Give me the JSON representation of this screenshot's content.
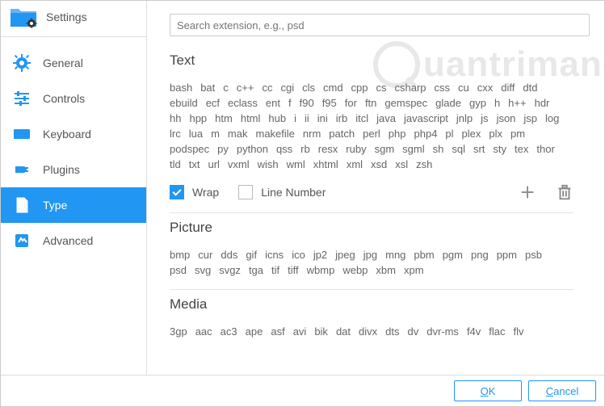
{
  "sidebar": {
    "title": "Settings",
    "items": [
      {
        "label": "General"
      },
      {
        "label": "Controls"
      },
      {
        "label": "Keyboard"
      },
      {
        "label": "Plugins"
      },
      {
        "label": "Type"
      },
      {
        "label": "Advanced"
      }
    ]
  },
  "watermark": "uantrimang",
  "search": {
    "placeholder": "Search extension, e.g., psd"
  },
  "sections": {
    "text": {
      "title": "Text",
      "extensions": [
        "bash",
        "bat",
        "c",
        "c++",
        "cc",
        "cgi",
        "cls",
        "cmd",
        "cpp",
        "cs",
        "csharp",
        "css",
        "cu",
        "cxx",
        "diff",
        "dtd",
        "ebuild",
        "ecf",
        "eclass",
        "ent",
        "f",
        "f90",
        "f95",
        "for",
        "ftn",
        "gemspec",
        "glade",
        "gyp",
        "h",
        "h++",
        "hdr",
        "hh",
        "hpp",
        "htm",
        "html",
        "hub",
        "i",
        "ii",
        "ini",
        "irb",
        "itcl",
        "java",
        "javascript",
        "jnlp",
        "js",
        "json",
        "jsp",
        "log",
        "lrc",
        "lua",
        "m",
        "mak",
        "makefile",
        "nrm",
        "patch",
        "perl",
        "php",
        "php4",
        "pl",
        "plex",
        "plx",
        "pm",
        "podspec",
        "py",
        "python",
        "qss",
        "rb",
        "resx",
        "ruby",
        "sgm",
        "sgml",
        "sh",
        "sql",
        "srt",
        "sty",
        "tex",
        "thor",
        "tld",
        "txt",
        "url",
        "vxml",
        "wish",
        "wml",
        "xhtml",
        "xml",
        "xsd",
        "xsl",
        "zsh"
      ]
    },
    "picture": {
      "title": "Picture",
      "extensions": [
        "bmp",
        "cur",
        "dds",
        "gif",
        "icns",
        "ico",
        "jp2",
        "jpeg",
        "jpg",
        "mng",
        "pbm",
        "pgm",
        "png",
        "ppm",
        "psb",
        "psd",
        "svg",
        "svgz",
        "tga",
        "tif",
        "tiff",
        "wbmp",
        "webp",
        "xbm",
        "xpm"
      ]
    },
    "media": {
      "title": "Media",
      "extensions": [
        "3gp",
        "aac",
        "ac3",
        "ape",
        "asf",
        "avi",
        "bik",
        "dat",
        "divx",
        "dts",
        "dv",
        "dvr-ms",
        "f4v",
        "flac",
        "flv"
      ]
    }
  },
  "options": {
    "wrap": "Wrap",
    "line_number": "Line Number"
  },
  "buttons": {
    "ok": "OK",
    "cancel": "Cancel"
  },
  "icons": {
    "add": "plus-icon",
    "delete": "trash-icon"
  }
}
